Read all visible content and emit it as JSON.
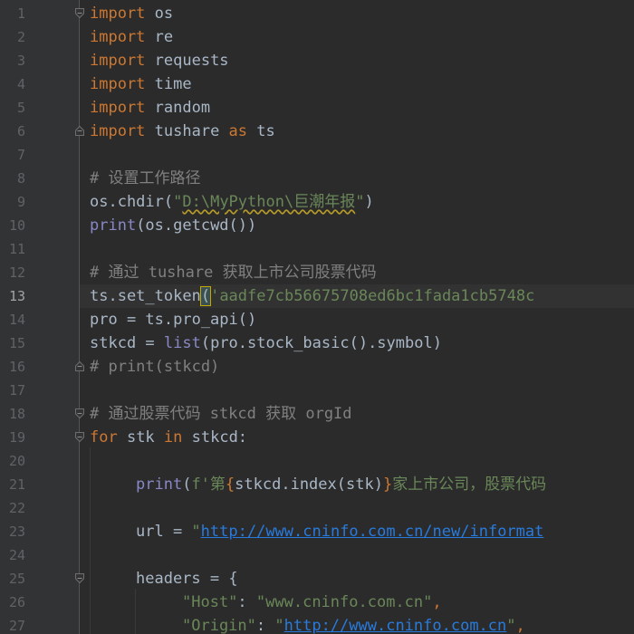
{
  "editor": {
    "current_line": 13,
    "colors": {
      "background": "#2b2b2b",
      "gutter": "#313335",
      "keyword": "#cc7832",
      "string": "#6a8759",
      "comment": "#808080",
      "builtin": "#8888c6",
      "text": "#a9b7c6",
      "link": "#287bde"
    },
    "line_numbers": [
      "1",
      "2",
      "3",
      "4",
      "5",
      "6",
      "7",
      "8",
      "9",
      "10",
      "11",
      "12",
      "13",
      "14",
      "15",
      "16",
      "17",
      "18",
      "19",
      "20",
      "21",
      "22",
      "23",
      "24",
      "25",
      "26",
      "27"
    ],
    "code": {
      "l1": {
        "kw": "import",
        "rest": " os"
      },
      "l2": {
        "kw": "import",
        "rest": " re"
      },
      "l3": {
        "kw": "import",
        "rest": " requests"
      },
      "l4": {
        "kw": "import",
        "rest": " time"
      },
      "l5": {
        "kw": "import",
        "rest": " random"
      },
      "l6": {
        "kw": "import",
        "mid": " tushare ",
        "kw2": "as",
        "rest": " ts"
      },
      "l8": {
        "comment": "# 设置工作路径"
      },
      "l9": {
        "a": "os.chdir(",
        "q1": "\"",
        "str": "D:\\MyPython\\巨潮年报",
        "q2": "\"",
        "b": ")"
      },
      "l10": {
        "bi": "print",
        "rest": "(os.getcwd())"
      },
      "l12": {
        "comment": "# 通过 tushare 获取上市公司股票代码"
      },
      "l13": {
        "a": "ts.set_token",
        "paren": "(",
        "str": "'aadfe7cb56675708ed6bc1fada1cb5748c"
      },
      "l14": {
        "text": "pro = ts.pro_api()"
      },
      "l15": {
        "a": "stkcd = ",
        "bi": "list",
        "rest": "(pro.stock_basic().symbol)"
      },
      "l16": {
        "comment": "# print(stkcd)"
      },
      "l18": {
        "comment": "# 通过股票代码 stkcd 获取 orgId"
      },
      "l19": {
        "kw": "for",
        "a": " stk ",
        "kw2": "in",
        "rest": " stkcd:"
      },
      "l21": {
        "bi": "print",
        "a": "(",
        "str1": "f'第",
        "brace1": "{",
        "mid": "stkcd.index(stk)",
        "brace2": "}",
        "str2": "家上市公司，股票代码"
      },
      "l23": {
        "a": "url = ",
        "q": "\"",
        "url": "http://www.cninfo.com.cn/new/informat"
      },
      "l25": {
        "text": "headers = {"
      },
      "l26": {
        "key": "\"Host\"",
        "colon": ": ",
        "val": "\"www.cninfo.com.cn\"",
        "comma": ","
      },
      "l27": {
        "key": "\"Origin\"",
        "colon": ": ",
        "q": "\"",
        "url": "http://www.cninfo.com.cn",
        "q2": "\"",
        "comma": ","
      }
    }
  }
}
